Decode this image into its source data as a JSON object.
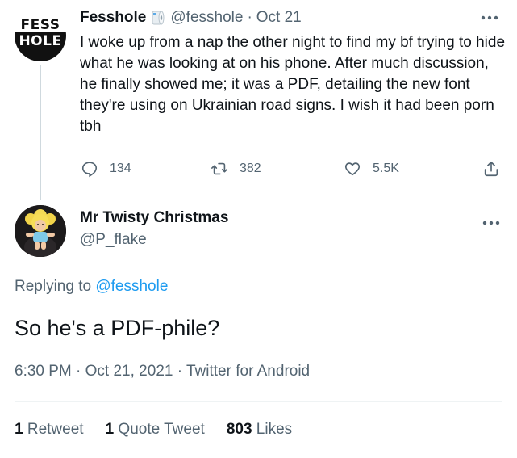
{
  "original_tweet": {
    "avatar_text_top": "FESS",
    "avatar_text_bottom": "HOLE",
    "display_name": "Fesshole",
    "handle": "@fesshole",
    "separator": "·",
    "date": "Oct 21",
    "more_icon": "more-horizontal-icon",
    "text": "I woke up from a nap the other night to find my bf trying to hide what he was looking at on his phone. After much discussion, he finally showed me; it was a PDF, detailing the new font they're using on Ukrainian road signs. I wish it had been porn tbh",
    "actions": {
      "reply_count": "134",
      "retweet_count": "382",
      "like_count": "5.5K"
    }
  },
  "reply_tweet": {
    "display_name": "Mr Twisty Christmas",
    "handle": "@P_flake",
    "replying_prefix": "Replying to",
    "replying_to": "@fesshole",
    "text": "So he's a PDF-phile?",
    "time": "6:30 PM",
    "date": "Oct 21, 2021",
    "client": "Twitter for Android",
    "separator": "·",
    "stats": {
      "retweets_num": "1",
      "retweets_label": "Retweet",
      "quotes_num": "1",
      "quotes_label": "Quote Tweet",
      "likes_num": "803",
      "likes_label": "Likes"
    }
  },
  "colors": {
    "text": "#0f1419",
    "muted": "#536471",
    "accent": "#1d9bf0",
    "line": "#cfd9de"
  }
}
